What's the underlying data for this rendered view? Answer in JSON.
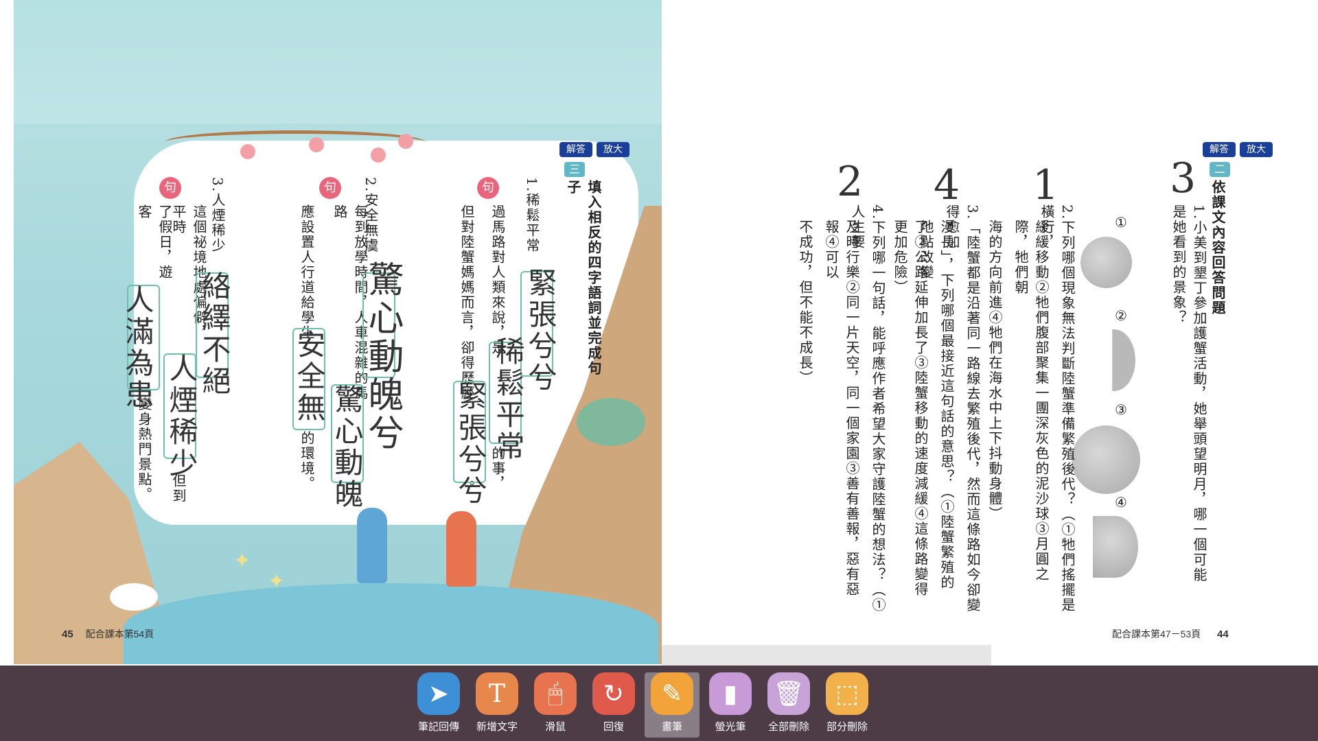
{
  "left_page": {
    "buttons": {
      "answer": "解答",
      "zoom": "放大"
    },
    "section_badge": "三",
    "instruction": "填入相反的四字語詞並完成句子",
    "ju_badge": "句",
    "items": [
      {
        "heading": "1.稀鬆平常",
        "sentence_a": "過馬路對人類來說，是",
        "sentence_b": "的事，",
        "sentence_c": "但對陸蟹媽媽而言，卻得歷經",
        "sentence_d": "。",
        "handwriting_1": "緊張兮兮",
        "handwriting_2": "稀鬆平常",
        "handwriting_3": "緊張兮兮"
      },
      {
        "heading": "2.安全無虞",
        "sentence_a": "每到放學時間，人車混雜的馬路",
        "sentence_b": "，",
        "sentence_c": "應設置人行道給學生",
        "sentence_d": "的環境。",
        "handwriting_1": "驚心動魄兮",
        "handwriting_2": "驚心動魄",
        "handwriting_3": "安全無"
      },
      {
        "heading": "3.人煙稀少",
        "sentence_a": "這個祕境地處偏僻，平時",
        "sentence_b": "，但到",
        "sentence_c": "了假日，遊客",
        "sentence_d": "變身熱門景點。",
        "handwriting_1": "絡繹不絕",
        "handwriting_2": "人煙稀少",
        "handwriting_3": "人滿為患"
      }
    ],
    "footer_page": "45",
    "footer_ref": "配合課本第54頁"
  },
  "right_page": {
    "buttons": {
      "answer": "解答",
      "zoom": "放大"
    },
    "section_badge": "二",
    "instruction": "依課文內容回答問題",
    "q1": "1.小美到墾丁參加護蟹活動，她舉頭望明月，哪一個可能是她看到的景象？",
    "moon_labels": [
      "①",
      "②",
      "③",
      "④"
    ],
    "q2a": "2.下列哪個現象無法判斷陸蟹準備繁殖後代？（①牠們搖擺是橫行，",
    "q2b": "緩緩移動②牠們腹部聚集一團深灰色的泥沙球③月圓之際，牠們朝",
    "q2c": "海的方向前進④牠們在海水中上下抖動身體）",
    "q3a": "3.「陸蟹都是沿著同一路線去繁殖後代，然而這條路如今卻變得愈加",
    "q3b": "漫長」，下列哪個最接近這句話的意思？（①陸蟹繁殖的地點改變",
    "q3c": "了②公路延伸加長了③陸蟹移動的速度減緩④這條路變得更加危險）",
    "q4a": "4.下列哪一句話，能呼應作者希望大家守護陸蟹的想法？（①人生要",
    "q4b": "及時行樂②同一片天空，同一個家園③善有善報，惡有惡報④可以",
    "q4c": "不成功，但不能不成長）",
    "answers": {
      "a1": "3",
      "a2": "1",
      "a3": "4",
      "a4": "2"
    },
    "footer_page": "44",
    "footer_ref": "配合課本第47－53頁"
  },
  "toolbar": {
    "items": [
      {
        "label": "筆記回傳",
        "icon": "send-icon"
      },
      {
        "label": "新增文字",
        "icon": "text-icon"
      },
      {
        "label": "滑鼠",
        "icon": "mouse-icon"
      },
      {
        "label": "回復",
        "icon": "undo-icon"
      },
      {
        "label": "畫筆",
        "icon": "pen-icon"
      },
      {
        "label": "螢光筆",
        "icon": "highlighter-icon"
      },
      {
        "label": "全部刪除",
        "icon": "trash-icon"
      },
      {
        "label": "部分刪除",
        "icon": "eraser-icon"
      }
    ],
    "active": "畫筆"
  }
}
